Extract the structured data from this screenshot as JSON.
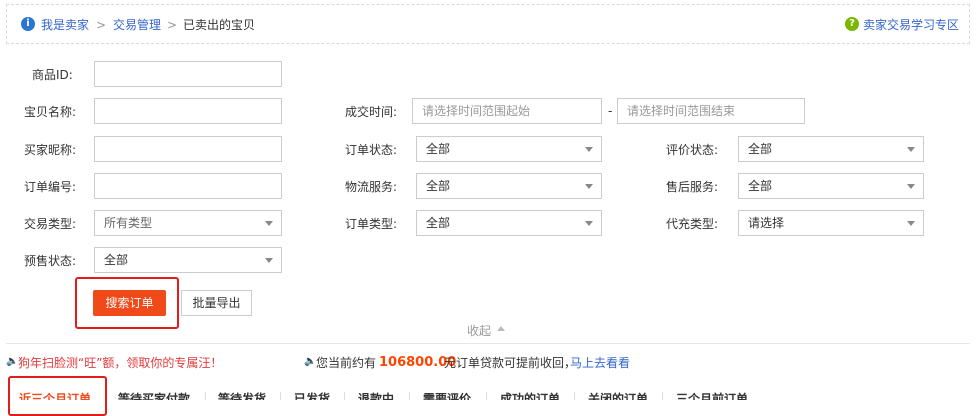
{
  "breadcrumb": {
    "items": [
      "我是卖家",
      "交易管理",
      "已卖出的宝贝"
    ],
    "separator": ">"
  },
  "help_link": "卖家交易学习专区",
  "form": {
    "product_id_label": "商品ID:",
    "item_name_label": "宝贝名称:",
    "buyer_nick_label": "买家昵称:",
    "order_no_label": "订单编号:",
    "trade_type_label": "交易类型:",
    "presale_label": "预售状态:",
    "deal_time_label": "成交时间:",
    "deal_time_start_placeholder": "请选择时间范围起始",
    "deal_time_end_placeholder": "请选择时间范围结束",
    "range_dash": "-",
    "order_status_label": "订单状态:",
    "logistics_label": "物流服务:",
    "order_type_label": "订单类型:",
    "review_status_label": "评价状态:",
    "after_sale_label": "售后服务:",
    "agent_type_label": "代充类型:",
    "trade_type_value": "所有类型",
    "presale_value": "全部",
    "order_status_value": "全部",
    "logistics_value": "全部",
    "order_type_value": "全部",
    "review_status_value": "全部",
    "after_sale_value": "全部",
    "agent_type_value": "请选择"
  },
  "buttons": {
    "search": "搜索订单",
    "export": "批量导出",
    "collapse": "收起"
  },
  "notices": {
    "promo": "狗年扫脸测“旺”额，领取你的专属汪！",
    "advance_prefix": "您当前约有",
    "advance_amount": "106800.00",
    "advance_suffix": "元订单贷款可提前收回，",
    "advance_link": "马上去看看"
  },
  "tabs": [
    "近三个月订单",
    "等待买家付款",
    "等待发货",
    "已发货",
    "退款中",
    "需要评价",
    "成功的订单",
    "关闭的订单",
    "三个月前订单"
  ],
  "colors": {
    "accent": "#f04a1b",
    "link": "#3366cc",
    "highlight": "#e21b1b"
  }
}
